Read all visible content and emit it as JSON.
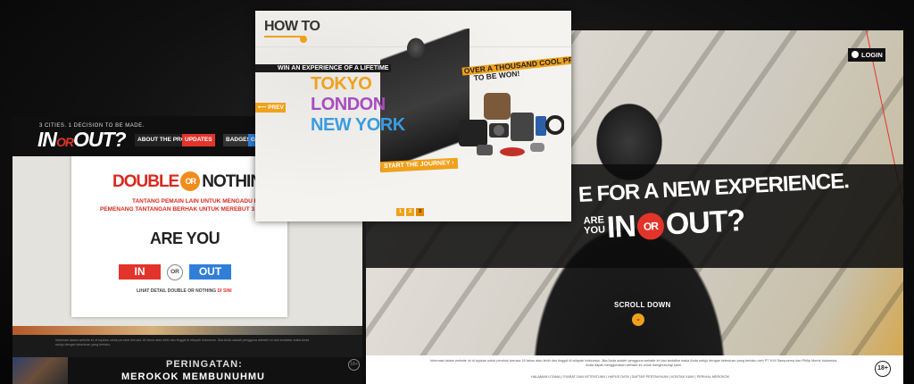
{
  "left_panel": {
    "tagline": "3 CITIES. 1 DECISION TO BE MADE.",
    "logo": {
      "in": "IN",
      "or": "OR",
      "out": "OUT?",
      "prefix": "ARE YOU"
    },
    "nav": [
      "ABOUT THE PROGRAM",
      "UPDATES",
      "BADGES",
      "GAMES"
    ],
    "modal": {
      "title_double": "DOUBLE",
      "title_or": "OR",
      "title_nothing": "NOTHING",
      "line1": "TANTANG PEMAIN LAIN UNTUK MENGADU POIN!?",
      "line2": "PEMENANG TANTANGAN BERHAK UNTUK MEREBUT 3 BADGES MILIK LAWANNYA!",
      "are_you": "ARE YOU",
      "colon": ":",
      "in_label": "IN",
      "or_label": "OR",
      "out_label": "OUT",
      "detail_prefix": "LIHAT DETAIL DOUBLE OR NOTHING",
      "detail_link": "DI SINI"
    },
    "footer_disclaimer": "Informasi dalam website ini di tujukan untuk perokok berusia 18 tahun atau lebih dan tinggal di wilayah Indonesia. Jika Anda adalah pengguna website ini dan terdaftar maka Anda setuju dengan ketentuan yang berlaku."
  },
  "warning": {
    "line1": "PERINGATAN:",
    "line2": "MEROKOK MEMBUNUHMU",
    "age": "18+"
  },
  "middle_panel": {
    "howto": "HOW TO",
    "win": "WIN AN EXPERIENCE OF A LIFETIME",
    "city1": "TOKYO",
    "city2": "LONDON",
    "city3": "NEW YORK",
    "prev": "⟵ PREV",
    "prizes_line1": "OVER A THOUSAND COOL PRIZES",
    "prizes_line2": "TO BE WON!",
    "start": "START THE JOURNEY ›",
    "pages": [
      "1",
      "2",
      "3"
    ],
    "active_page": "3"
  },
  "right_panel": {
    "login": "LOGIN",
    "headline": "E FOR A NEW EXPERIENCE.",
    "are": "ARE",
    "you": "YOU",
    "in": "IN",
    "or": "OR",
    "out": "OUT?",
    "scroll": "SCROLL DOWN",
    "scroll_icon": "⌄",
    "footer_disclaimer": "Informasi dalam website ini di tujukan untuk perokok berusia 18 tahun atau lebih dan tinggal di wilayah Indonesia. Jika Anda adalah pengguna website ini dan terdaftar maka Anda setuju dengan ketentuan yang berlaku oleh PT H.M Sampoerna dan Philip Morris Indonesia. Anda dapat menggunakan website ini untuk menghubungi kami.",
    "footer_links": "HALAMAN UTAMA  |  SYARAT DAN KETENTUAN  |  HAPUS DATA  |  DAFTAR PERTANYAAN  |  KONTAK KAMI  |  PERIHAL MEROKOK",
    "age": "18+"
  },
  "colors": {
    "accent_orange": "#f0a11c",
    "brand_red": "#e3342b",
    "out_blue": "#2f7fd9",
    "london_purple": "#a94cc1",
    "ny_blue": "#3a9ce0"
  }
}
